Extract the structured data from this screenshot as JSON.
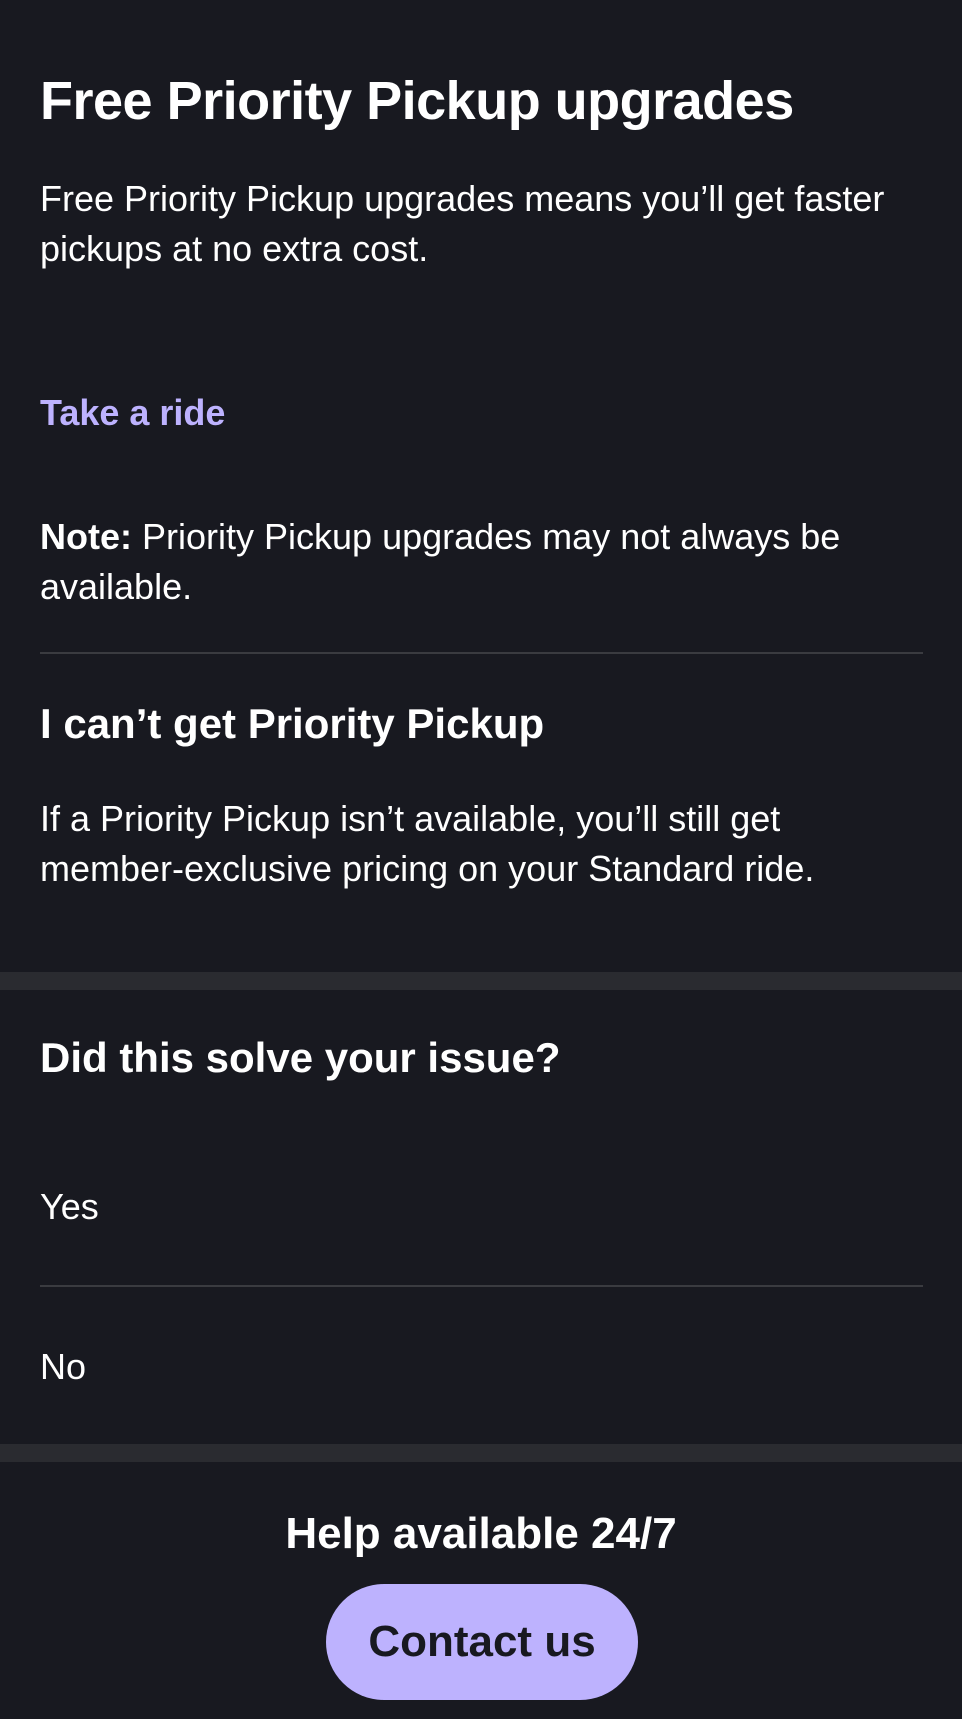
{
  "article": {
    "title": "Free Priority Pickup upgrades",
    "intro": "Free Priority Pickup upgrades means you’ll get faster pickups at no extra cost.",
    "link_label": "Take a ride",
    "note_label": "Note:",
    "note_text": " Priority Pickup upgrades may not always be available."
  },
  "section": {
    "heading": "I can’t get Priority Pickup",
    "body": "If a Priority Pickup isn’t available, you’ll still get member-exclusive pricing on your Standard ride."
  },
  "feedback": {
    "question": "Did this solve your issue?",
    "options": [
      "Yes",
      "No"
    ]
  },
  "help": {
    "title": "Help available 24/7",
    "button_label": "Contact us"
  },
  "colors": {
    "background": "#181920",
    "accent": "#bdb2fe",
    "divider": "#3a3b40",
    "band": "#2a2b30"
  }
}
